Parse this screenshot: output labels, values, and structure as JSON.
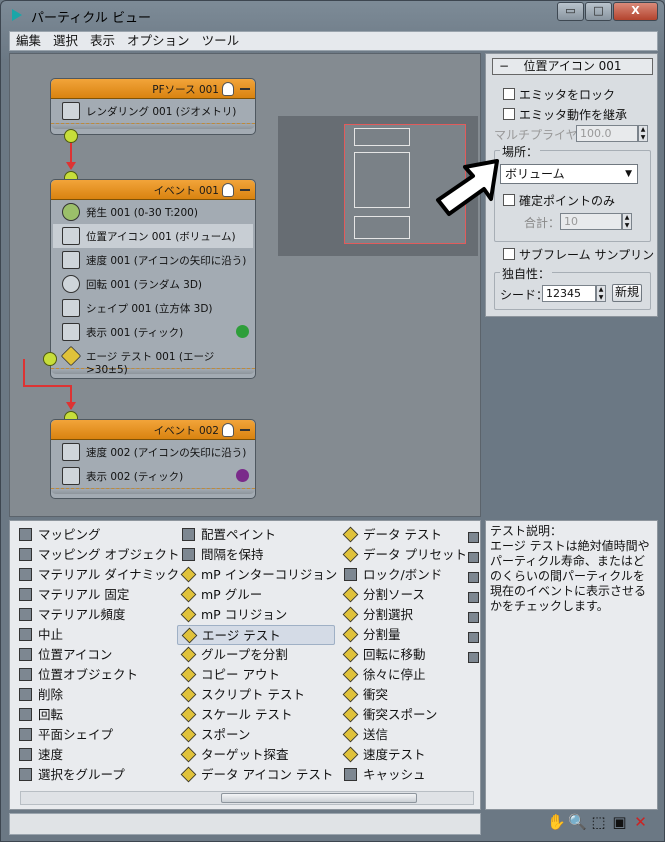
{
  "window": {
    "title": "パーティクル ビュー",
    "controls": {
      "minimize": "▭",
      "maximize": "□",
      "close": "X"
    }
  },
  "menu": [
    "編集",
    "選択",
    "表示",
    "オプション",
    "ツール"
  ],
  "events": [
    {
      "title": "PFソース 001",
      "operators": [
        {
          "label": "レンダリング 001 (ジオメトリ)"
        }
      ]
    },
    {
      "title": "イベント 001",
      "operators": [
        {
          "label": "発生 001 (0-30 T:200)"
        },
        {
          "label": "位置アイコン 001 (ボリューム)"
        },
        {
          "label": "速度 001 (アイコンの矢印に沿う)"
        },
        {
          "label": "回転 001 (ランダム 3D)"
        },
        {
          "label": "シェイプ 001 (立方体 3D)"
        },
        {
          "label": "表示 001 (ティック)"
        },
        {
          "label": "エージ テスト 001 (エージ>30±5)"
        }
      ]
    },
    {
      "title": "イベント 002",
      "operators": [
        {
          "label": "速度 002 (アイコンの矢印に沿う)"
        },
        {
          "label": "表示 002 (ティック)"
        }
      ]
    }
  ],
  "rollout": {
    "header": "位置アイコン 001",
    "collapse": "−",
    "lock_emitter": "エミッタをロック",
    "inherit_motion": "エミッタ動作を継承",
    "multiplier_label": "マルチプライヤ%",
    "multiplier_value": "100.0",
    "location_label": "場所：",
    "location_value": "ボリューム",
    "distinct_only": "確定ポイントのみ",
    "total_label": "合計：",
    "total_value": "10",
    "subframe": "サブフレーム サンプリング",
    "uniqueness_label": "独自性：",
    "seed_label": "シード：",
    "seed_value": "12345",
    "new_button": "新規"
  },
  "depot": {
    "columns": [
      [
        "マッピング",
        "マッピング オブジェクト",
        "マテリアル ダイナミック",
        "マテリアル 固定",
        "マテリアル頻度",
        "中止",
        "位置アイコン",
        "位置オブジェクト",
        "削除",
        "回転",
        "平面シェイプ",
        "速度",
        "選択をグループ"
      ],
      [
        "配置ペイント",
        "間隔を保持",
        "mP インターコリジョン",
        "mP グルー",
        "mP コリジョン",
        "エージ テスト",
        "グループを分割",
        "コピー アウト",
        "スクリプト テスト",
        "スケール テスト",
        "スポーン",
        "ターゲット探査",
        "データ アイコン テスト"
      ],
      [
        "データ テスト",
        "データ プリセット",
        "ロック/ボンド",
        "分割ソース",
        "分割選択",
        "分割量",
        "回転に移動",
        "徐々に停止",
        "衝突",
        "衝突スポーン",
        "送信",
        "速度テスト",
        "キャッシュ"
      ]
    ],
    "selected": "エージ テスト"
  },
  "description": {
    "title": "テスト説明：",
    "text": "エージ テストは絶対値時間やパーティクル寿命、またはどのくらいの間パーティクルを現在のイベントに表示させるかをチェックします。"
  },
  "display_colors": {
    "event1": "#2e9e3a",
    "event2": "#7a2a8a"
  }
}
